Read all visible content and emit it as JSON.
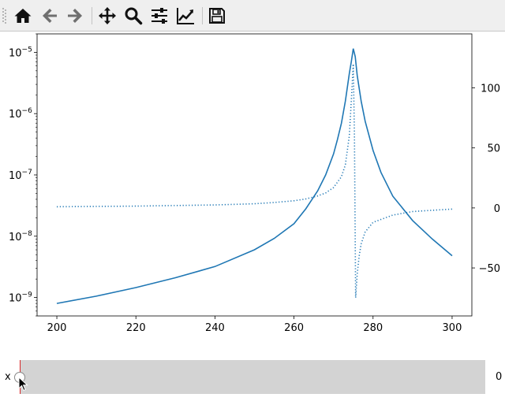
{
  "toolbar": {
    "buttons": [
      {
        "name": "home-button",
        "icon": "home-icon"
      },
      {
        "name": "back-button",
        "icon": "arrow-left-icon"
      },
      {
        "name": "forward-button",
        "icon": "arrow-right-icon"
      },
      {
        "name": "pan-button",
        "icon": "move-icon"
      },
      {
        "name": "zoom-button",
        "icon": "magnifier-icon"
      },
      {
        "name": "configure-subplots-button",
        "icon": "sliders-icon"
      },
      {
        "name": "edit-axis-button",
        "icon": "line-chart-icon"
      },
      {
        "name": "save-button",
        "icon": "floppy-disk-icon"
      }
    ]
  },
  "chart_data": {
    "type": "line",
    "title": "",
    "xlabel": "",
    "ylabel_left": "",
    "ylabel_right": "",
    "color": "#1f77b4",
    "xlim": [
      195,
      305
    ],
    "x_ticks": [
      200,
      220,
      240,
      260,
      280,
      300
    ],
    "left_axis": {
      "scale": "log",
      "ylim": [
        5e-10,
        2e-05
      ],
      "ticks": [
        {
          "value": 1e-09,
          "base": "10",
          "exp": "−9"
        },
        {
          "value": 1e-08,
          "base": "10",
          "exp": "−8"
        },
        {
          "value": 1e-07,
          "base": "10",
          "exp": "−7"
        },
        {
          "value": 1e-06,
          "base": "10",
          "exp": "−6"
        },
        {
          "value": 1e-05,
          "base": "10",
          "exp": "−5"
        }
      ]
    },
    "right_axis": {
      "scale": "linear",
      "ylim": [
        -90,
        145
      ],
      "ticks": [
        -50,
        0,
        50,
        100
      ]
    },
    "series": [
      {
        "axis": "left",
        "style": "solid",
        "x": [
          200,
          210,
          220,
          230,
          240,
          250,
          255,
          260,
          263,
          266,
          268,
          270,
          271,
          272,
          273,
          274,
          274.5,
          275,
          275.5,
          276,
          277,
          278,
          280,
          282,
          285,
          290,
          295,
          300
        ],
        "y": [
          8e-10,
          1.05e-09,
          1.45e-09,
          2.1e-09,
          3.2e-09,
          6e-09,
          9.2e-09,
          1.6e-08,
          2.8e-08,
          5.5e-08,
          1e-07,
          2.2e-07,
          3.8e-07,
          7e-07,
          1.6e-06,
          4.5e-06,
          7e-06,
          1.15e-05,
          8.5e-06,
          4.2e-06,
          1.6e-06,
          7.5e-07,
          2.5e-07,
          1.1e-07,
          4.5e-08,
          1.8e-08,
          9e-09,
          4.8e-09
        ]
      },
      {
        "axis": "right",
        "style": "dotted",
        "x": [
          200,
          220,
          240,
          250,
          255,
          260,
          263,
          266,
          268,
          270,
          272,
          273,
          274,
          274.6,
          275,
          275.3,
          275.6,
          276,
          276.5,
          277,
          278,
          280,
          285,
          290,
          295,
          300
        ],
        "y": [
          1,
          1.5,
          2.5,
          3.5,
          4.5,
          6,
          7.5,
          10,
          12.5,
          17,
          26,
          36,
          60,
          95,
          120,
          60,
          -75,
          -55,
          -40,
          -30,
          -20,
          -12,
          -6,
          -3,
          -2,
          -1
        ]
      }
    ]
  },
  "slider": {
    "label": "x",
    "value": "0"
  }
}
